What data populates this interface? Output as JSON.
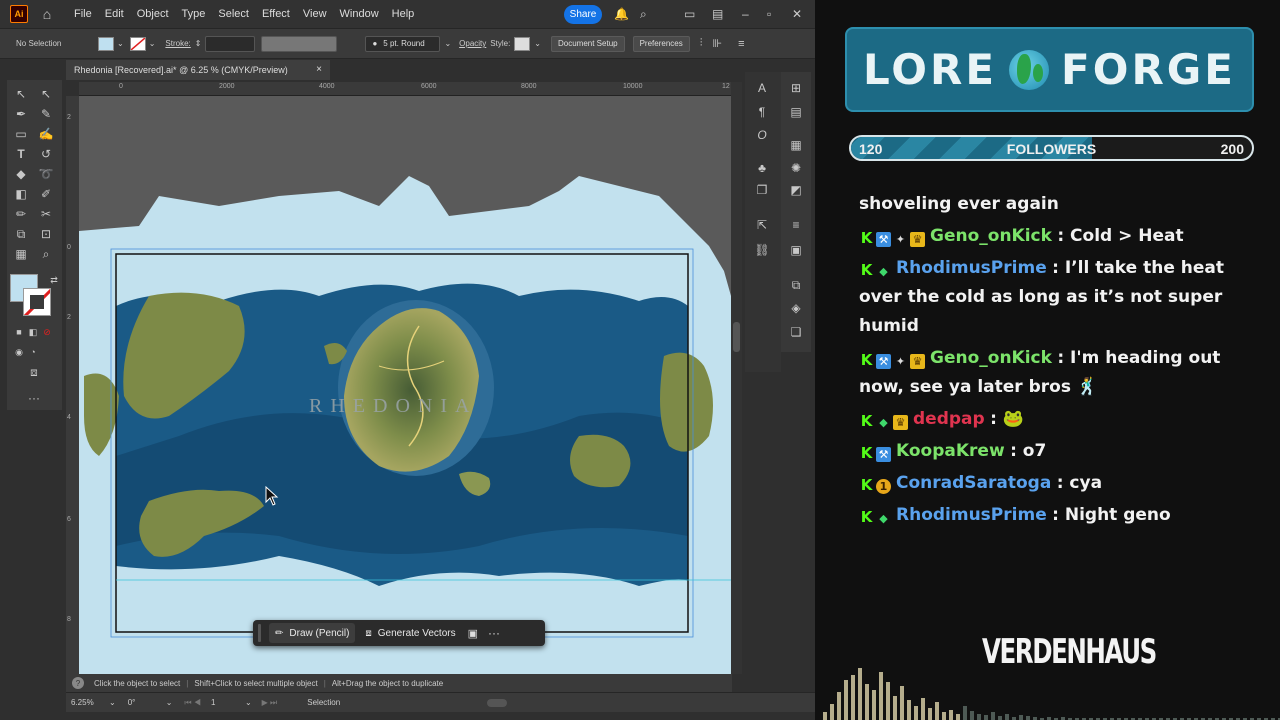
{
  "menubar": {
    "logo": "Ai",
    "items": [
      "File",
      "Edit",
      "Object",
      "Type",
      "Select",
      "Effect",
      "View",
      "Window",
      "Help"
    ],
    "share_label": "Share"
  },
  "control_bar": {
    "selection": "No Selection",
    "stroke_label": "Stroke:",
    "brush": "5 pt. Round",
    "opacity_label": "Opacity",
    "style_label": "Style:",
    "document_setup": "Document Setup",
    "preferences": "Preferences"
  },
  "document_tab": {
    "title": "Rhedonia [Recovered].ai* @ 6.25 % (CMYK/Preview)",
    "close": "×"
  },
  "ruler_h": [
    "0",
    "2000",
    "4000",
    "6000",
    "8000",
    "10000",
    "12"
  ],
  "ruler_v": [
    "2",
    "0",
    "2",
    "4",
    "6",
    "8"
  ],
  "map_label": "RHEDONIA",
  "context_bar": {
    "draw_label": "Draw (Pencil)",
    "generate_label": "Generate Vectors",
    "more": "···"
  },
  "status_hint": {
    "a": "Click the object to select",
    "b": "Shift+Click to select multiple object",
    "c": "Alt+Drag the object to duplicate"
  },
  "bottom_bar": {
    "zoom": "6.25%",
    "rotation": "0°",
    "artboard": "1",
    "mode": "Selection"
  },
  "overlay": {
    "logo_left": "LORE",
    "logo_right": "FORGE",
    "followers": {
      "current": "120",
      "label": "FOLLOWERS",
      "goal": "200",
      "progress": 0.6
    },
    "chat": [
      {
        "user": "",
        "color": "",
        "badges": [],
        "text": "shoveling ever again"
      },
      {
        "user": "Geno_onKick",
        "color": "#7ce36a",
        "badges": [
          "k",
          "blue",
          "star",
          "crown"
        ],
        "text": ": Cold > Heat"
      },
      {
        "user": "RhodimusPrime",
        "color": "#5aa2ee",
        "badges": [
          "k",
          "green"
        ],
        "text": ": I’ll take the heat over the cold as long as it’s not super humid"
      },
      {
        "user": "Geno_onKick",
        "color": "#7ce36a",
        "badges": [
          "k",
          "blue",
          "star",
          "crown"
        ],
        "text": ": I'm heading out now, see ya later bros 🕺"
      },
      {
        "user": "dedpap",
        "color": "#e0344f",
        "badges": [
          "k",
          "green",
          "crown"
        ],
        "text": ": 🐸"
      },
      {
        "user": "KoopaKrew",
        "color": "#7ce36a",
        "badges": [
          "k",
          "blue"
        ],
        "text": ": o7"
      },
      {
        "user": "ConradSaratoga",
        "color": "#5aa2ee",
        "badges": [
          "k",
          "coin"
        ],
        "text": ": cya"
      },
      {
        "user": "RhodimusPrime",
        "color": "#5aa2ee",
        "badges": [
          "k",
          "green"
        ],
        "text": ": Night geno"
      }
    ],
    "sponsor": "VERDENHAUS"
  }
}
